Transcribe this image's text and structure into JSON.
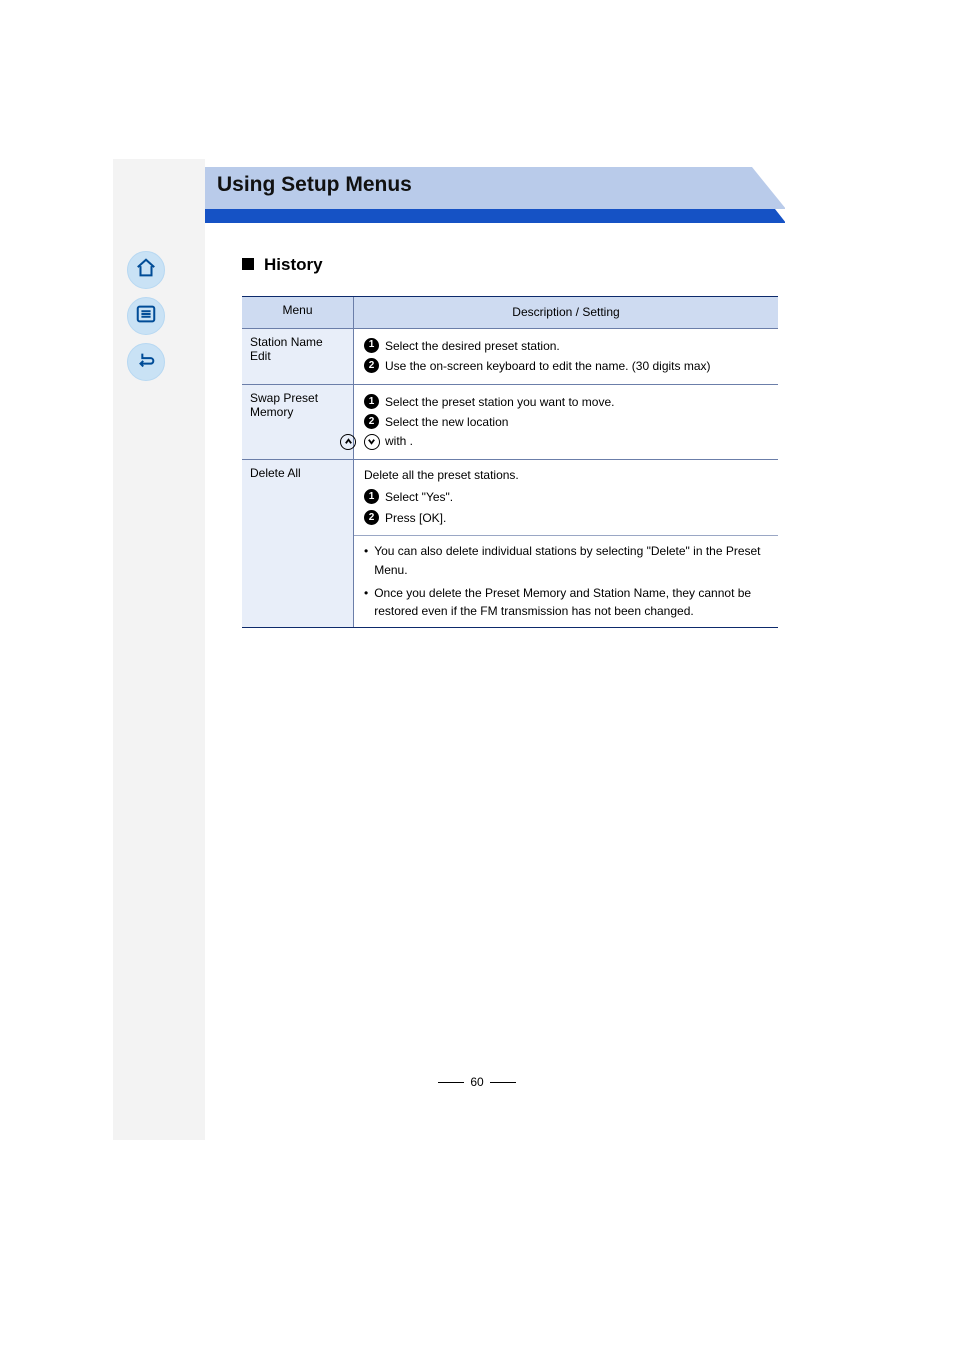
{
  "header": {
    "title": "Using Setup Menus"
  },
  "section_title": "History",
  "table": {
    "columns": {
      "key": "Menu",
      "val": "Description / Setting"
    },
    "rows": [
      {
        "key": "Station Name Edit",
        "steps": [
          "Select the desired preset station.",
          "Use the on-screen keyboard to edit the name. (30 digits max)"
        ]
      },
      {
        "key": "Swap Preset Memory",
        "steps": [
          "Select the preset station you want to move.",
          "Select the new location with            ."
        ]
      },
      {
        "key": "Delete All",
        "lead": "Delete all the preset stations.",
        "steps": [
          "Select \"Yes\".",
          "Press [OK]."
        ],
        "notes": [
          "You can also delete individual stations by selecting \"Delete\" in the Preset Menu.",
          "Once you delete the Preset Memory and Station Name, they cannot be restored even if the FM transmission has not been changed."
        ]
      }
    ]
  },
  "page_number": "60"
}
